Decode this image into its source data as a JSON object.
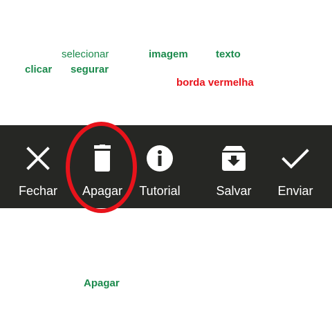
{
  "annotations": {
    "selecionar": "selecionar",
    "imagem": "imagem",
    "texto": "texto",
    "clicar": "clicar",
    "segurar": "segurar",
    "borda_vermelha": "borda vermelha",
    "apagar": "Apagar"
  },
  "colors": {
    "annotation_green": "#1b8a4c",
    "annotation_red": "#e8131b",
    "toolbar_bg": "#262724",
    "toolbar_fg": "#ffffff"
  },
  "toolbar": {
    "items": [
      {
        "label": "Fechar",
        "icon": "close-icon"
      },
      {
        "label": "Apagar",
        "icon": "trash-icon",
        "highlighted": true
      },
      {
        "label": "Tutorial",
        "icon": "info-icon"
      },
      {
        "label": "Salvar",
        "icon": "archive-download-icon"
      },
      {
        "label": "Enviar",
        "icon": "checkmark-icon"
      }
    ]
  }
}
